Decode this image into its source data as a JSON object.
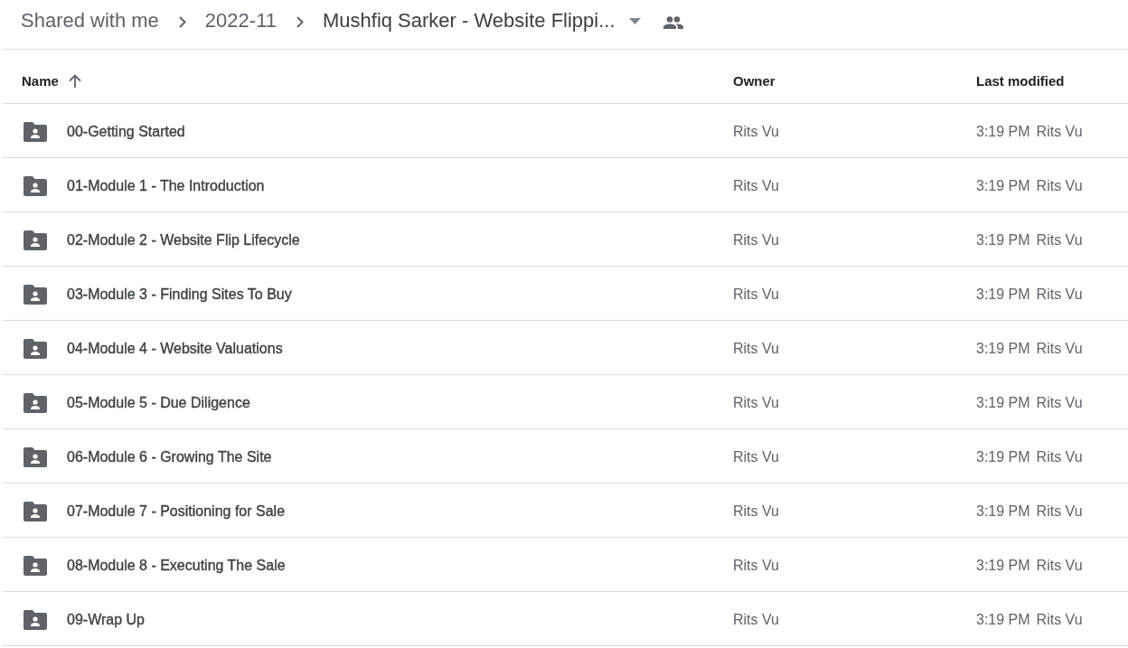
{
  "breadcrumb": {
    "items": [
      "Shared with me",
      "2022-11"
    ],
    "current": "Mushfiq Sarker - Website Flippi..."
  },
  "table": {
    "columns": [
      {
        "label": "Name",
        "sorted": true
      },
      {
        "label": "Owner",
        "sorted": false
      },
      {
        "label": "Last modified",
        "sorted": false
      }
    ],
    "rows": [
      {
        "name": "00-Getting Started",
        "owner": "Rits Vu",
        "modified_time": "3:19 PM",
        "modified_by": "Rits Vu"
      },
      {
        "name": "01-Module 1 - The Introduction",
        "owner": "Rits Vu",
        "modified_time": "3:19 PM",
        "modified_by": "Rits Vu"
      },
      {
        "name": "02-Module 2 - Website Flip Lifecycle",
        "owner": "Rits Vu",
        "modified_time": "3:19 PM",
        "modified_by": "Rits Vu"
      },
      {
        "name": "03-Module 3 - Finding Sites To Buy",
        "owner": "Rits Vu",
        "modified_time": "3:19 PM",
        "modified_by": "Rits Vu"
      },
      {
        "name": "04-Module 4 - Website Valuations",
        "owner": "Rits Vu",
        "modified_time": "3:19 PM",
        "modified_by": "Rits Vu"
      },
      {
        "name": "05-Module 5 - Due Diligence",
        "owner": "Rits Vu",
        "modified_time": "3:19 PM",
        "modified_by": "Rits Vu"
      },
      {
        "name": "06-Module 6 - Growing The Site",
        "owner": "Rits Vu",
        "modified_time": "3:19 PM",
        "modified_by": "Rits Vu"
      },
      {
        "name": "07-Module 7 - Positioning for Sale",
        "owner": "Rits Vu",
        "modified_time": "3:19 PM",
        "modified_by": "Rits Vu"
      },
      {
        "name": "08-Module 8 - Executing The Sale",
        "owner": "Rits Vu",
        "modified_time": "3:19 PM",
        "modified_by": "Rits Vu"
      },
      {
        "name": "09-Wrap Up",
        "owner": "Rits Vu",
        "modified_time": "3:19 PM",
        "modified_by": "Rits Vu"
      }
    ]
  }
}
